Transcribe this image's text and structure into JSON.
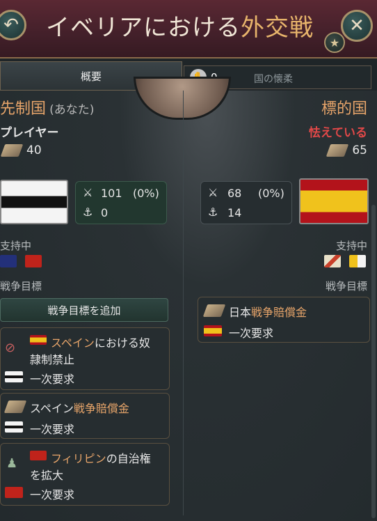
{
  "header": {
    "title_prefix": "イベリアにおける",
    "title_highlight": "外交戦",
    "back_icon": "undo-arrow-icon",
    "close_icon": "close-icon",
    "star_icon": "star-icon"
  },
  "tabs": {
    "overview": "概要",
    "count": "0",
    "appeasement": "国の懐柔"
  },
  "left": {
    "side_label": "先制国",
    "side_note": "(あなた)",
    "player": "プレイヤー",
    "stat": "40",
    "army": "101",
    "army_pct": "(0%)",
    "navy": "0",
    "supporting": "支持中",
    "war_goals": "戦争目標",
    "add_goal": "戦争目標を追加"
  },
  "right": {
    "side_label": "標的国",
    "status": "怯えている",
    "stat": "65",
    "army": "68",
    "army_pct": "(0%)",
    "navy": "14",
    "supporting": "支持中",
    "war_goals": "戦争目標"
  },
  "goals_left": [
    {
      "title_hl": "スペイン",
      "title_rest": "における奴",
      "title_line2": "隷制禁止",
      "demand": "一次要求"
    },
    {
      "title_pre": "スペイン",
      "title_hl": "戦争賠償金",
      "demand": "一次要求"
    },
    {
      "title_hl": "フィリピン",
      "title_rest": "の自治権",
      "title_line2": "を拡大",
      "demand": "一次要求"
    }
  ],
  "goal_right": {
    "title_pre": "日本",
    "title_hl": "戦争賠償金",
    "demand": "一次要求"
  },
  "colors": {
    "accent": "#e8a56a",
    "threat": "#e04848",
    "header": "#4a2430"
  }
}
